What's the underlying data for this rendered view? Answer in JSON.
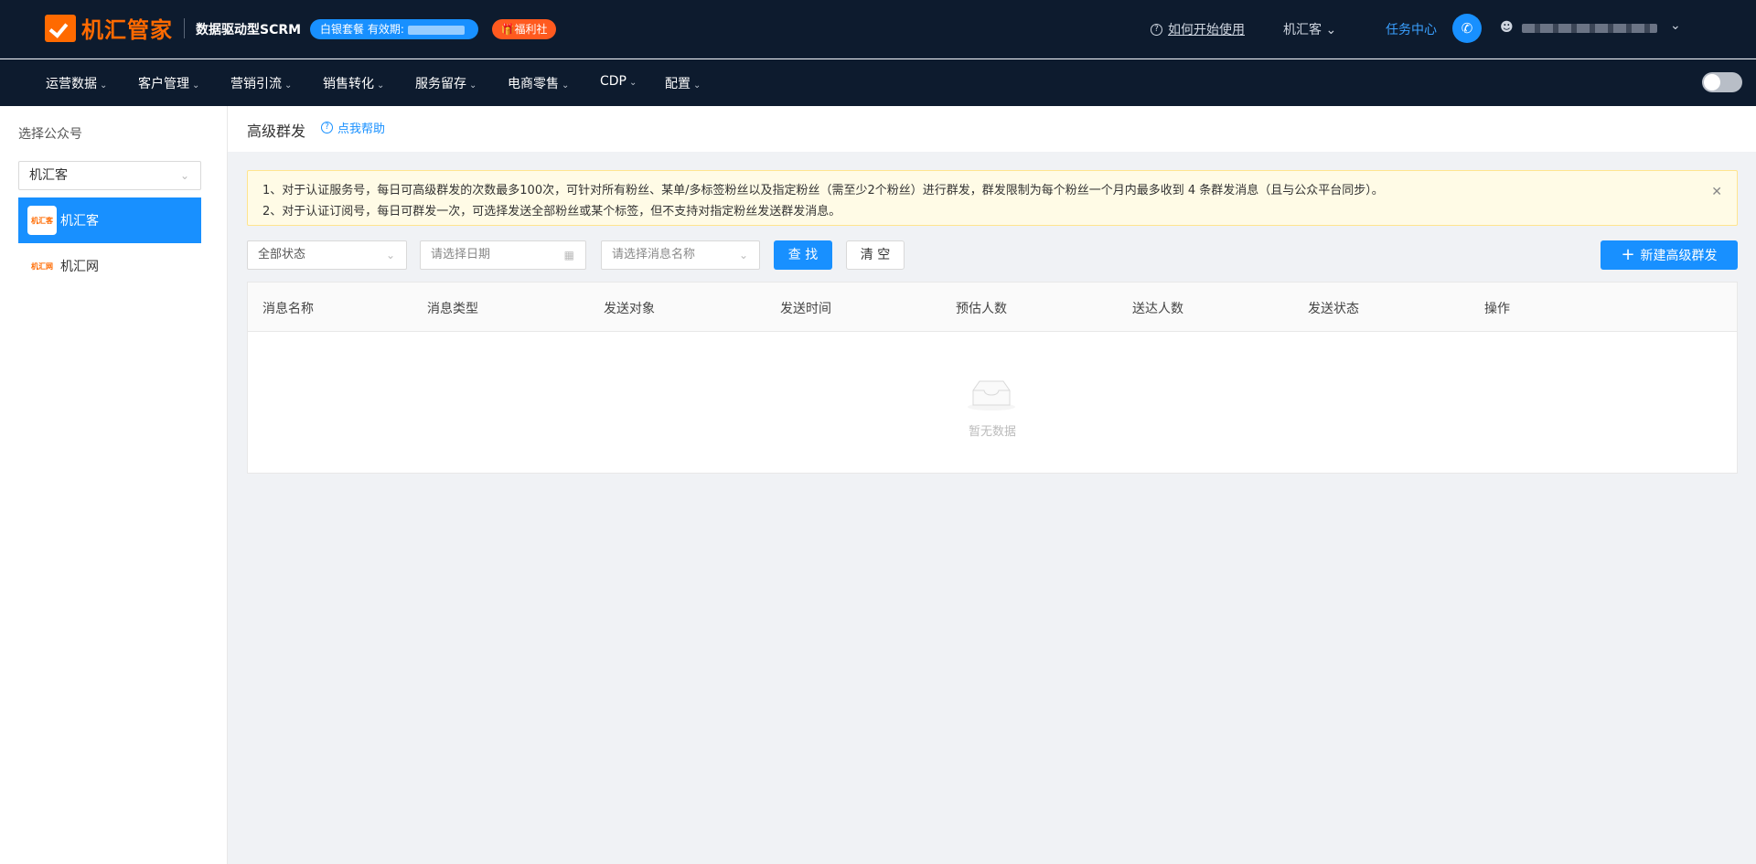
{
  "header": {
    "logo_text": "机汇管家",
    "subtitle": "数据驱动型SCRM",
    "plan_label": "白银套餐  有效期:",
    "welfare_label": "🎁福利社",
    "help_link": "如何开始使用",
    "account_switch": "机汇客",
    "task_center": "任务中心"
  },
  "nav": {
    "items": [
      {
        "label": "运营数据"
      },
      {
        "label": "客户管理"
      },
      {
        "label": "营销引流"
      },
      {
        "label": "销售转化"
      },
      {
        "label": "服务留存"
      },
      {
        "label": "电商零售"
      },
      {
        "label": "CDP"
      },
      {
        "label": "配置"
      }
    ]
  },
  "sidebar": {
    "title": "选择公众号",
    "select_value": "机汇客",
    "accounts": [
      {
        "logo": "机汇客",
        "name": "机汇客"
      },
      {
        "logo": "机汇网",
        "name": "机汇网"
      }
    ]
  },
  "page": {
    "title": "高级群发",
    "help": "点我帮助"
  },
  "notice": {
    "line1": "1、对于认证服务号，每日可高级群发的次数最多100次，可针对所有粉丝、某单/多标签粉丝以及指定粉丝（需至少2个粉丝）进行群发，群发限制为每个粉丝一个月内最多收到 4 条群发消息（且与公众平台同步）。",
    "line2": "2、对于认证订阅号，每日可群发一次，可选择发送全部粉丝或某个标签，但不支持对指定粉丝发送群发消息。"
  },
  "filters": {
    "status": "全部状态",
    "date_placeholder": "请选择日期",
    "name_placeholder": "请选择消息名称",
    "search_btn": "查 找",
    "clear_btn": "清 空",
    "new_btn": "新建高级群发"
  },
  "table": {
    "columns": [
      "消息名称",
      "消息类型",
      "发送对象",
      "发送时间",
      "预估人数",
      "送达人数",
      "发送状态",
      "操作"
    ],
    "empty_text": "暂无数据"
  }
}
